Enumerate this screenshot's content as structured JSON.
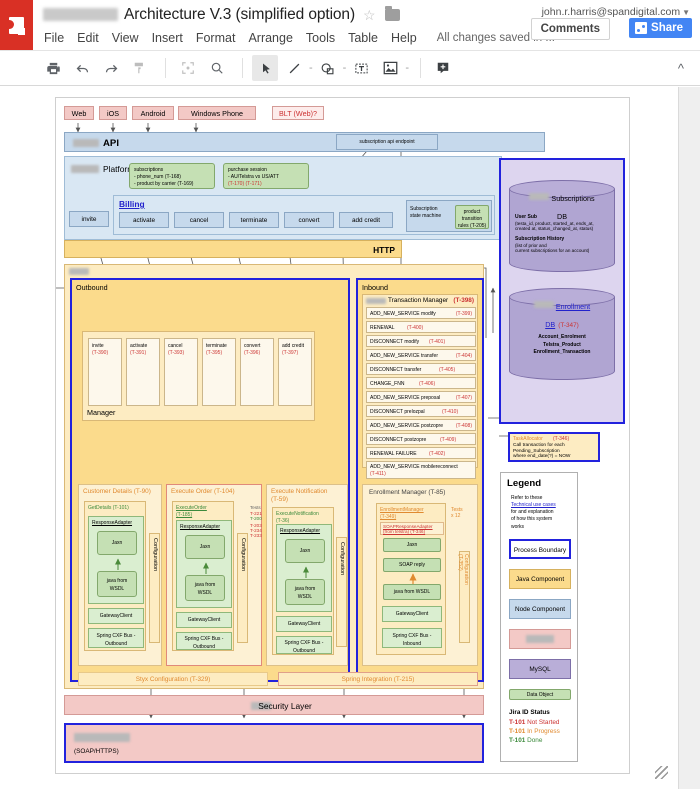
{
  "header": {
    "doc_title": "Architecture V.3 (simplified option)",
    "redacted_prefix": true,
    "account": "john.r.harris@spandigital.com",
    "menus": [
      "File",
      "Edit",
      "View",
      "Insert",
      "Format",
      "Arrange",
      "Tools",
      "Table",
      "Help"
    ],
    "save_status": "All changes saved in ...",
    "comments_label": "Comments",
    "share_label": "Share"
  },
  "toolbar": {
    "icons": [
      "print-icon",
      "undo-icon",
      "redo-icon",
      "paint-format-icon",
      "fit-screen-icon",
      "zoom-icon",
      "select-arrow-icon",
      "line-icon",
      "shape-icon",
      "textbox-icon",
      "image-icon",
      "comment-icon"
    ],
    "collapse_label": "^"
  },
  "diagram": {
    "clients": [
      "Web",
      "iOS",
      "Android",
      "Windows Phone"
    ],
    "blt_label": "BLT (Web)?",
    "api_label": "API",
    "api_endpoint": "subscription api endpoint",
    "platform_label": "Platform",
    "notes": [
      {
        "title": "subscriptions",
        "lines": [
          "- phone_num (T-168)",
          "- product by carrier (T-169)"
        ]
      },
      {
        "title": "purchase session",
        "lines": [
          "- AU/Telstra vs US/ATT",
          "(T-170) (T-171)"
        ]
      }
    ],
    "billing_label": "Billing",
    "billing_ops": [
      "activate",
      "cancel",
      "terminate",
      "convert",
      "add credit"
    ],
    "invite_label": "invite",
    "state_machine_label": "Subscription\nstate machine",
    "state_machine_note": "product\ntransition\nrules (T-205)",
    "http_label": "HTTP",
    "outbound_label": "Outbound",
    "inbound_label": "Inbound",
    "manager_label": "Manager",
    "manager_ops": [
      {
        "name": "invite",
        "id": "(T-390)"
      },
      {
        "name": "activate",
        "id": "(T-391)"
      },
      {
        "name": "cancel",
        "id": "(T-393)"
      },
      {
        "name": "terminate",
        "id": "(T-395)"
      },
      {
        "name": "convert",
        "id": "(T-396)"
      },
      {
        "name": "add credit",
        "id": "(T-397)"
      }
    ],
    "txmgr": {
      "title": "Transaction Manager",
      "title_id": "(T-398)",
      "rows": [
        {
          "name": "ADD_NEW_SERVICE modify",
          "id": "(T-399)"
        },
        {
          "name": "RENEWAL",
          "id": "(T-400)"
        },
        {
          "name": "DISCONNECT modify",
          "id": "(T-401)"
        },
        {
          "name": "ADD_NEW_SERVICE transfer",
          "id": "(T-404)"
        },
        {
          "name": "DISCONNECT transfer",
          "id": "(T-405)"
        },
        {
          "name": "CHANGE_FNN",
          "id": "(T-406)"
        },
        {
          "name": "ADD_NEW_SERVICE preposal",
          "id": "(T-407)"
        },
        {
          "name": "DISCONNECT prelozpal",
          "id": "(T-410)"
        },
        {
          "name": "ADD_NEW_SERVICE postzopre",
          "id": "(T-408)"
        },
        {
          "name": "DISCONNECT postzopre",
          "id": "(T-409)"
        },
        {
          "name": "RENEWAL FAILURE",
          "id": "(T-402)"
        },
        {
          "name": "ADD_NEW_SERVICE mobilereconnect",
          "id": "(T-411)"
        }
      ]
    },
    "components": [
      {
        "title": "Customer Details (T-90)",
        "inner_title": "GetDetails (T-101)",
        "adapter": "ResponseAdapter",
        "steps": [
          "Jaxn",
          "java from\nWSDL"
        ],
        "gateway": "GatewayClient",
        "bus": "Spring CXF Bus -\nOutbound",
        "config": "Configuration",
        "tests": null
      },
      {
        "title": "Execute Order (T-104)",
        "inner_title": "ExecuteOrder\n(T-185)",
        "adapter": "ResponseAdapter",
        "steps": [
          "Jaxn",
          "java from\nWSDL"
        ],
        "gateway": "GatewayClient",
        "bus": "Spring CXF Bus -\nOutbound",
        "config": "Configuration",
        "tests": {
          "label": "Tests",
          "ids": [
            "T-221",
            "T-200",
            "T-203",
            "T-234",
            "T-233"
          ]
        }
      },
      {
        "title": "Execute Notification\n(T-59)",
        "inner_title": "ExecuteNotification\n(T-36)",
        "adapter": "ResponseAdapter",
        "steps": [
          "Jaxn",
          "java from\nWSDL"
        ],
        "gateway": "GatewayClient",
        "bus": "Spring CXF Bus -\nOutbound",
        "config": "Configuration",
        "tests": null
      },
      {
        "title": "Enrollment Manager (T-85)",
        "inner_title": "EnrollmentManager\n(T-349)",
        "adapter": "SOAPResponseAdapter\n(from telstra) (T-346)",
        "steps": [
          "Jaxn",
          "SOAP reply",
          "java from WSDL"
        ],
        "gateway": "GatewayClient",
        "bus": "Spring CXF Bus -\nInbound",
        "config": "Configuration\n(T-352)",
        "tests": {
          "label": "Tests\nx 12",
          "ids": []
        }
      }
    ],
    "styx_config": "Styx Configuration (T-329)",
    "spring_integration": "Spring Integration (T-215)",
    "security_layer": "Security Layer",
    "soap_label": "(SOAP/HTTPS)",
    "db": {
      "subscriptions_title": "Subscriptions\nDB",
      "user_sub_heading": "User Sub",
      "user_sub_fields": "(testa_id, product, started_at, ends_at,\ncreated at, status_changed_at, status)",
      "history_heading": "Subscription History",
      "history_text": "(list of prior and\ncurrent subscriptions for an account)",
      "enrollment_title": "Enrollment\nDB",
      "enrollment_id": "(T-347)",
      "enrollment_tables": "Account_Enrolment\nTelstra_Product\nEnrollment_Transaction"
    },
    "task_allocator": {
      "title": "TaskAllocator",
      "id": "(T-346)",
      "body": "Call transaction for each\nPending_Subscription\nwhere end_date(?) = NOW"
    },
    "legend": {
      "title": "Legend",
      "intro_1": "Refer to these",
      "intro_link": "Technical use cases",
      "intro_2": "for and explanation\nof how this system\nworks",
      "items": [
        {
          "label": "Process Boundary",
          "kind": "process"
        },
        {
          "label": "Java Component",
          "kind": "java"
        },
        {
          "label": "Node Component",
          "kind": "node"
        },
        {
          "label": "",
          "kind": "redacted"
        },
        {
          "label": "MySQL",
          "kind": "mysql"
        },
        {
          "label": "Data Object",
          "kind": "data"
        }
      ],
      "jira_heading": "Jira ID Status",
      "jira_rows": [
        {
          "id": "T-101",
          "state": "Not Started",
          "color": "#cc3333"
        },
        {
          "id": "T-101",
          "state": "In Progress",
          "color": "#e08a30"
        },
        {
          "id": "T-101",
          "state": "Done",
          "color": "#3c8a3c"
        }
      ]
    }
  },
  "colors": {
    "brand_red": "#d93025",
    "share_blue": "#4285f4",
    "process_boundary": "#2222dd",
    "java_component": "#fbdb8c",
    "node_component": "#c6d9ec",
    "mysql": "#b9aed8",
    "data_object": "#c5e0b4",
    "not_started": "#cc3333",
    "in_progress": "#e08a30",
    "done": "#3c8a3c"
  }
}
